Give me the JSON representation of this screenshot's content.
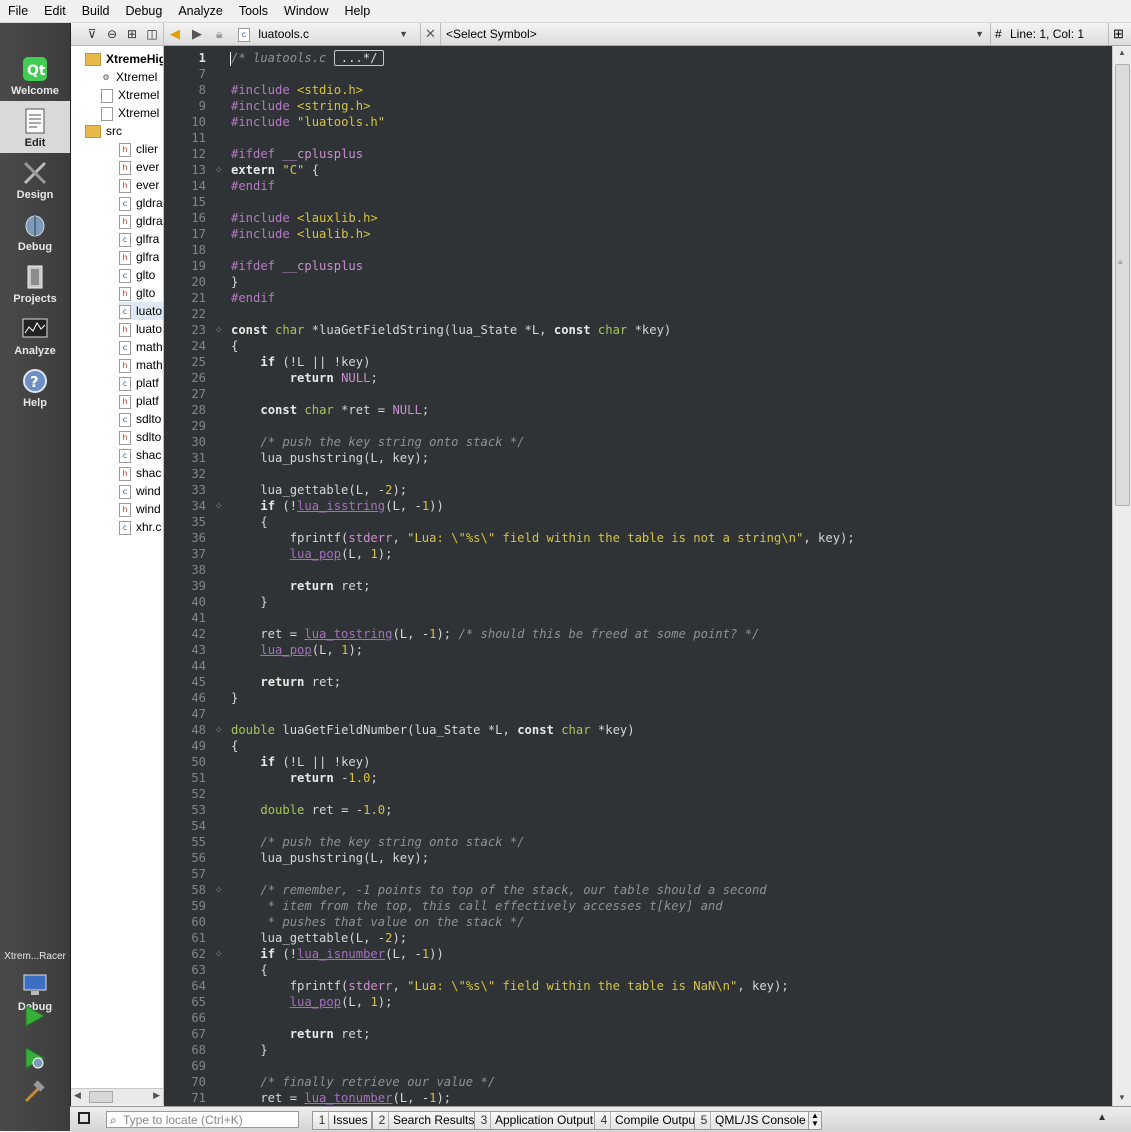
{
  "menu": [
    "File",
    "Edit",
    "Build",
    "Debug",
    "Analyze",
    "Tools",
    "Window",
    "Help"
  ],
  "modes": [
    {
      "name": "welcome",
      "label": "Welcome",
      "icon": "qt-logo-icon"
    },
    {
      "name": "edit",
      "label": "Edit",
      "icon": "document-edit-icon",
      "active": true
    },
    {
      "name": "design",
      "label": "Design",
      "icon": "design-tools-icon"
    },
    {
      "name": "debug",
      "label": "Debug",
      "icon": "debug-bug-icon"
    },
    {
      "name": "projects",
      "label": "Projects",
      "icon": "projects-folder-icon"
    },
    {
      "name": "analyze",
      "label": "Analyze",
      "icon": "analyze-monitor-icon"
    },
    {
      "name": "help",
      "label": "Help",
      "icon": "help-icon"
    }
  ],
  "run_target": {
    "project": "Xtrem...Racer",
    "mode": "Debug"
  },
  "tree": [
    {
      "label": "XtremeHig",
      "kind": "folder",
      "indent": 1,
      "bold": true
    },
    {
      "label": "Xtremel",
      "kind": "pro",
      "indent": 2
    },
    {
      "label": "Xtremel",
      "kind": "file",
      "indent": 2
    },
    {
      "label": "Xtremel",
      "kind": "file",
      "indent": 2
    },
    {
      "label": "src",
      "kind": "folder",
      "indent": 1
    },
    {
      "label": "clier",
      "kind": "h",
      "indent": 3
    },
    {
      "label": "ever",
      "kind": "h",
      "indent": 3
    },
    {
      "label": "ever",
      "kind": "h",
      "indent": 3
    },
    {
      "label": "gldra",
      "kind": "c",
      "indent": 3
    },
    {
      "label": "gldra",
      "kind": "h",
      "indent": 3
    },
    {
      "label": "glfra",
      "kind": "c",
      "indent": 3
    },
    {
      "label": "glfra",
      "kind": "h",
      "indent": 3
    },
    {
      "label": "glto",
      "kind": "c",
      "indent": 3
    },
    {
      "label": "glto",
      "kind": "h",
      "indent": 3
    },
    {
      "label": "luato",
      "kind": "c",
      "indent": 3,
      "selected": true
    },
    {
      "label": "luato",
      "kind": "h",
      "indent": 3
    },
    {
      "label": "math",
      "kind": "c",
      "indent": 3
    },
    {
      "label": "math",
      "kind": "h",
      "indent": 3
    },
    {
      "label": "platf",
      "kind": "c",
      "indent": 3
    },
    {
      "label": "platf",
      "kind": "h",
      "indent": 3
    },
    {
      "label": "sdlto",
      "kind": "c",
      "indent": 3
    },
    {
      "label": "sdlto",
      "kind": "h",
      "indent": 3
    },
    {
      "label": "shac",
      "kind": "c",
      "indent": 3
    },
    {
      "label": "shac",
      "kind": "h",
      "indent": 3
    },
    {
      "label": "wind",
      "kind": "c",
      "indent": 3
    },
    {
      "label": "wind",
      "kind": "h",
      "indent": 3
    },
    {
      "label": "xhr.c",
      "kind": "c",
      "indent": 3
    }
  ],
  "editor_toolbar": {
    "file": "luatools.c",
    "symbol": "<Select Symbol>",
    "position": "Line: 1, Col: 1",
    "hash": "#"
  },
  "code": [
    {
      "n": "1",
      "t": [
        [
          "cm",
          "/* luatools.c "
        ],
        [
          "box",
          "...*/"
        ]
      ]
    },
    {
      "n": "7",
      "t": []
    },
    {
      "n": "8",
      "t": [
        [
          "pp",
          "#include "
        ],
        [
          "st",
          "<stdio.h>"
        ]
      ]
    },
    {
      "n": "9",
      "t": [
        [
          "pp",
          "#include "
        ],
        [
          "st",
          "<string.h>"
        ]
      ]
    },
    {
      "n": "10",
      "t": [
        [
          "pp",
          "#include "
        ],
        [
          "st",
          "\"luatools.h\""
        ]
      ]
    },
    {
      "n": "11",
      "t": []
    },
    {
      "n": "12",
      "t": [
        [
          "pp",
          "#ifdef "
        ],
        [
          "mc",
          "__cplusplus"
        ]
      ]
    },
    {
      "n": "13",
      "t": [
        [
          "kw",
          "extern "
        ],
        [
          "st",
          "\"C\""
        ],
        [
          "fn",
          " {"
        ]
      ],
      "fold": true
    },
    {
      "n": "14",
      "t": [
        [
          "pp",
          "#endif"
        ]
      ]
    },
    {
      "n": "15",
      "t": []
    },
    {
      "n": "16",
      "t": [
        [
          "pp",
          "#include "
        ],
        [
          "st",
          "<lauxlib.h>"
        ]
      ]
    },
    {
      "n": "17",
      "t": [
        [
          "pp",
          "#include "
        ],
        [
          "st",
          "<lualib.h>"
        ]
      ]
    },
    {
      "n": "18",
      "t": []
    },
    {
      "n": "19",
      "t": [
        [
          "pp",
          "#ifdef "
        ],
        [
          "mc",
          "__cplusplus"
        ]
      ]
    },
    {
      "n": "20",
      "t": [
        [
          "fn",
          "}"
        ]
      ]
    },
    {
      "n": "21",
      "t": [
        [
          "pp",
          "#endif"
        ]
      ]
    },
    {
      "n": "22",
      "t": []
    },
    {
      "n": "23",
      "t": [
        [
          "kw",
          "const "
        ],
        [
          "ty",
          "char "
        ],
        [
          "fn",
          "*luaGetFieldString(lua_State *L, "
        ],
        [
          "kw",
          "const "
        ],
        [
          "ty",
          "char "
        ],
        [
          "fn",
          "*key)"
        ]
      ],
      "fold": true
    },
    {
      "n": "24",
      "t": [
        [
          "fn",
          "{"
        ]
      ]
    },
    {
      "n": "25",
      "t": [
        [
          "fn",
          "    "
        ],
        [
          "kw",
          "if "
        ],
        [
          "fn",
          "(!L || !key)"
        ]
      ]
    },
    {
      "n": "26",
      "t": [
        [
          "fn",
          "        "
        ],
        [
          "kw",
          "return "
        ],
        [
          "mc",
          "NULL"
        ],
        [
          "fn",
          ";"
        ]
      ]
    },
    {
      "n": "27",
      "t": []
    },
    {
      "n": "28",
      "t": [
        [
          "fn",
          "    "
        ],
        [
          "kw",
          "const "
        ],
        [
          "ty",
          "char "
        ],
        [
          "fn",
          "*ret = "
        ],
        [
          "mc",
          "NULL"
        ],
        [
          "fn",
          ";"
        ]
      ]
    },
    {
      "n": "29",
      "t": []
    },
    {
      "n": "30",
      "t": [
        [
          "fn",
          "    "
        ],
        [
          "cm",
          "/* push the key string onto stack */"
        ]
      ]
    },
    {
      "n": "31",
      "t": [
        [
          "fn",
          "    lua_pushstring(L, key);"
        ]
      ]
    },
    {
      "n": "32",
      "t": []
    },
    {
      "n": "33",
      "t": [
        [
          "fn",
          "    lua_gettable(L, -"
        ],
        [
          "nm",
          "2"
        ],
        [
          "fn",
          ");"
        ]
      ]
    },
    {
      "n": "34",
      "t": [
        [
          "fn",
          "    "
        ],
        [
          "kw",
          "if "
        ],
        [
          "fn",
          "(!"
        ],
        [
          "fx",
          "lua_isstring"
        ],
        [
          "fn",
          "(L, -"
        ],
        [
          "nm",
          "1"
        ],
        [
          "fn",
          "))"
        ]
      ],
      "fold": true
    },
    {
      "n": "35",
      "t": [
        [
          "fn",
          "    {"
        ]
      ]
    },
    {
      "n": "36",
      "t": [
        [
          "fn",
          "        fprintf("
        ],
        [
          "mc",
          "stderr"
        ],
        [
          "fn",
          ", "
        ],
        [
          "st",
          "\"Lua: \\\"%s\\\" field within the table is not a string\\n\""
        ],
        [
          "fn",
          ", key);"
        ]
      ]
    },
    {
      "n": "37",
      "t": [
        [
          "fn",
          "        "
        ],
        [
          "fx",
          "lua_pop"
        ],
        [
          "fn",
          "(L, "
        ],
        [
          "nm",
          "1"
        ],
        [
          "fn",
          ");"
        ]
      ]
    },
    {
      "n": "38",
      "t": []
    },
    {
      "n": "39",
      "t": [
        [
          "fn",
          "        "
        ],
        [
          "kw",
          "return "
        ],
        [
          "fn",
          "ret;"
        ]
      ]
    },
    {
      "n": "40",
      "t": [
        [
          "fn",
          "    }"
        ]
      ]
    },
    {
      "n": "41",
      "t": []
    },
    {
      "n": "42",
      "t": [
        [
          "fn",
          "    ret = "
        ],
        [
          "fx",
          "lua_tostring"
        ],
        [
          "fn",
          "(L, -"
        ],
        [
          "nm",
          "1"
        ],
        [
          "fn",
          "); "
        ],
        [
          "cm",
          "/* should this be freed at some point? */"
        ]
      ]
    },
    {
      "n": "43",
      "t": [
        [
          "fn",
          "    "
        ],
        [
          "fx",
          "lua_pop"
        ],
        [
          "fn",
          "(L, "
        ],
        [
          "nm",
          "1"
        ],
        [
          "fn",
          ");"
        ]
      ]
    },
    {
      "n": "44",
      "t": []
    },
    {
      "n": "45",
      "t": [
        [
          "fn",
          "    "
        ],
        [
          "kw",
          "return "
        ],
        [
          "fn",
          "ret;"
        ]
      ]
    },
    {
      "n": "46",
      "t": [
        [
          "fn",
          "}"
        ]
      ]
    },
    {
      "n": "47",
      "t": []
    },
    {
      "n": "48",
      "t": [
        [
          "ty",
          "double "
        ],
        [
          "fn",
          "luaGetFieldNumber(lua_State *L, "
        ],
        [
          "kw",
          "const "
        ],
        [
          "ty",
          "char "
        ],
        [
          "fn",
          "*key)"
        ]
      ],
      "fold": true
    },
    {
      "n": "49",
      "t": [
        [
          "fn",
          "{"
        ]
      ]
    },
    {
      "n": "50",
      "t": [
        [
          "fn",
          "    "
        ],
        [
          "kw",
          "if "
        ],
        [
          "fn",
          "(!L || !key)"
        ]
      ]
    },
    {
      "n": "51",
      "t": [
        [
          "fn",
          "        "
        ],
        [
          "kw",
          "return "
        ],
        [
          "fn",
          "-"
        ],
        [
          "nm",
          "1.0"
        ],
        [
          "fn",
          ";"
        ]
      ]
    },
    {
      "n": "52",
      "t": []
    },
    {
      "n": "53",
      "t": [
        [
          "fn",
          "    "
        ],
        [
          "ty",
          "double "
        ],
        [
          "fn",
          "ret = -"
        ],
        [
          "nm",
          "1.0"
        ],
        [
          "fn",
          ";"
        ]
      ]
    },
    {
      "n": "54",
      "t": []
    },
    {
      "n": "55",
      "t": [
        [
          "fn",
          "    "
        ],
        [
          "cm",
          "/* push the key string onto stack */"
        ]
      ]
    },
    {
      "n": "56",
      "t": [
        [
          "fn",
          "    lua_pushstring(L, key);"
        ]
      ]
    },
    {
      "n": "57",
      "t": []
    },
    {
      "n": "58",
      "t": [
        [
          "fn",
          "    "
        ],
        [
          "cm",
          "/* remember, -1 points to top of the stack, our table should a second"
        ]
      ],
      "fold": true
    },
    {
      "n": "59",
      "t": [
        [
          "cm",
          "     * item from the top, this call effectively accesses t[key] and"
        ]
      ]
    },
    {
      "n": "60",
      "t": [
        [
          "cm",
          "     * pushes that value on the stack */"
        ]
      ]
    },
    {
      "n": "61",
      "t": [
        [
          "fn",
          "    lua_gettable(L, -"
        ],
        [
          "nm",
          "2"
        ],
        [
          "fn",
          ");"
        ]
      ]
    },
    {
      "n": "62",
      "t": [
        [
          "fn",
          "    "
        ],
        [
          "kw",
          "if "
        ],
        [
          "fn",
          "(!"
        ],
        [
          "fx",
          "lua_isnumber"
        ],
        [
          "fn",
          "(L, -"
        ],
        [
          "nm",
          "1"
        ],
        [
          "fn",
          "))"
        ]
      ],
      "fold": true
    },
    {
      "n": "63",
      "t": [
        [
          "fn",
          "    {"
        ]
      ]
    },
    {
      "n": "64",
      "t": [
        [
          "fn",
          "        fprintf("
        ],
        [
          "mc",
          "stderr"
        ],
        [
          "fn",
          ", "
        ],
        [
          "st",
          "\"Lua: \\\"%s\\\" field within the table is NaN\\n\""
        ],
        [
          "fn",
          ", key);"
        ]
      ]
    },
    {
      "n": "65",
      "t": [
        [
          "fn",
          "        "
        ],
        [
          "fx",
          "lua_pop"
        ],
        [
          "fn",
          "(L, "
        ],
        [
          "nm",
          "1"
        ],
        [
          "fn",
          ");"
        ]
      ]
    },
    {
      "n": "66",
      "t": []
    },
    {
      "n": "67",
      "t": [
        [
          "fn",
          "        "
        ],
        [
          "kw",
          "return "
        ],
        [
          "fn",
          "ret;"
        ]
      ]
    },
    {
      "n": "68",
      "t": [
        [
          "fn",
          "    }"
        ]
      ]
    },
    {
      "n": "69",
      "t": []
    },
    {
      "n": "70",
      "t": [
        [
          "fn",
          "    "
        ],
        [
          "cm",
          "/* finally retrieve our value */"
        ]
      ]
    },
    {
      "n": "71",
      "t": [
        [
          "fn",
          "    ret = "
        ],
        [
          "fx",
          "lua_tonumber"
        ],
        [
          "fn",
          "(L, -"
        ],
        [
          "nm",
          "1"
        ],
        [
          "fn",
          ");"
        ]
      ]
    }
  ],
  "statusbar": {
    "locate_placeholder": "Type to locate (Ctrl+K)",
    "panes": [
      {
        "num": "1",
        "label": "Issues"
      },
      {
        "num": "2",
        "label": "Search Results"
      },
      {
        "num": "3",
        "label": "Application Output"
      },
      {
        "num": "4",
        "label": "Compile Output"
      },
      {
        "num": "5",
        "label": "QML/JS Console"
      }
    ]
  }
}
